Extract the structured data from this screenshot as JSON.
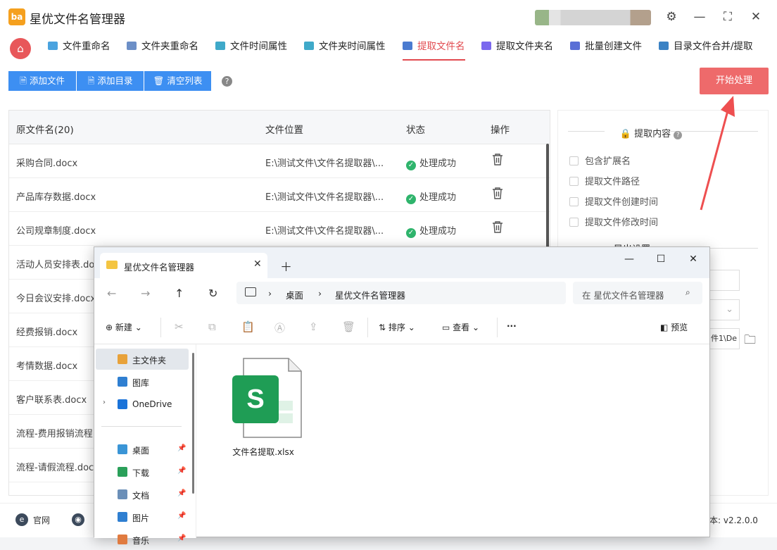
{
  "app": {
    "title": "星优文件名管理器",
    "logo_text": "ba"
  },
  "tabs": [
    {
      "label": "文件重命名",
      "color": "#4aa3df"
    },
    {
      "label": "文件夹重命名",
      "color": "#6c8fc7"
    },
    {
      "label": "文件时间属性",
      "color": "#3fa9c9"
    },
    {
      "label": "文件夹时间属性",
      "color": "#3fa9c9"
    },
    {
      "label": "提取文件名",
      "color": "#4a7bd0"
    },
    {
      "label": "提取文件夹名",
      "color": "#7b68ee"
    },
    {
      "label": "批量创建文件",
      "color": "#5a6fd6"
    },
    {
      "label": "目录文件合并/提取",
      "color": "#3b82c4"
    }
  ],
  "toolbar": {
    "add_file": "添加文件",
    "add_dir": "添加目录",
    "clear_list": "清空列表",
    "help": "?",
    "start": "开始处理"
  },
  "table": {
    "headers": {
      "name": "原文件名(20)",
      "location": "文件位置",
      "status": "状态",
      "action": "操作"
    },
    "rows": [
      {
        "name": "采购合同.docx",
        "location": "E:\\测试文件\\文件名提取器\\...",
        "status": "处理成功"
      },
      {
        "name": "产品库存数据.docx",
        "location": "E:\\测试文件\\文件名提取器\\...",
        "status": "处理成功"
      },
      {
        "name": "公司规章制度.docx",
        "location": "E:\\测试文件\\文件名提取器\\...",
        "status": "处理成功"
      },
      {
        "name": "活动人员安排表.do",
        "location": "",
        "status": ""
      },
      {
        "name": "今日会议安排.docx",
        "location": "",
        "status": ""
      },
      {
        "name": "经费报销.docx",
        "location": "",
        "status": ""
      },
      {
        "name": "考情数据.docx",
        "location": "",
        "status": ""
      },
      {
        "name": "客户联系表.docx",
        "location": "",
        "status": ""
      },
      {
        "name": "流程-费用报销流程",
        "location": "",
        "status": ""
      },
      {
        "name": "流程-请假流程.doc",
        "location": "",
        "status": ""
      }
    ]
  },
  "panel": {
    "section1": "提取内容",
    "options": [
      "包含扩展名",
      "提取文件路径",
      "提取文件创建时间",
      "提取文件修改时间"
    ],
    "section2": "导出设置",
    "path_partial": "件1\\De"
  },
  "statusbar": {
    "website": "官网",
    "version": "本: v2.2.0.0"
  },
  "explorer": {
    "tab_title": "星优文件名管理器",
    "breadcrumb": [
      "桌面",
      "星优文件名管理器"
    ],
    "search_placeholder": "在 星优文件名管理器",
    "commands": {
      "new": "新建",
      "sort": "排序",
      "view": "查看",
      "more": "···",
      "preview": "预览"
    },
    "nav": [
      {
        "label": "主文件夹",
        "icon": "home-icon",
        "color": "#e8a23a"
      },
      {
        "label": "图库",
        "icon": "gallery-icon",
        "color": "#2f7fd1"
      },
      {
        "label": "OneDrive",
        "icon": "cloud-icon",
        "color": "#1a73d9"
      },
      {
        "label": "桌面",
        "icon": "desktop-icon",
        "color": "#3a95d6"
      },
      {
        "label": "下载",
        "icon": "download-icon",
        "color": "#2aa05a"
      },
      {
        "label": "文档",
        "icon": "document-icon",
        "color": "#6b8fb8"
      },
      {
        "label": "图片",
        "icon": "picture-icon",
        "color": "#2f7fd1"
      },
      {
        "label": "音乐",
        "icon": "music-icon",
        "color": "#e07b40"
      }
    ],
    "file": {
      "name": "文件名提取.xlsx",
      "icon": "spreadsheet-icon",
      "badge": "S",
      "color": "#1f9d55"
    }
  }
}
